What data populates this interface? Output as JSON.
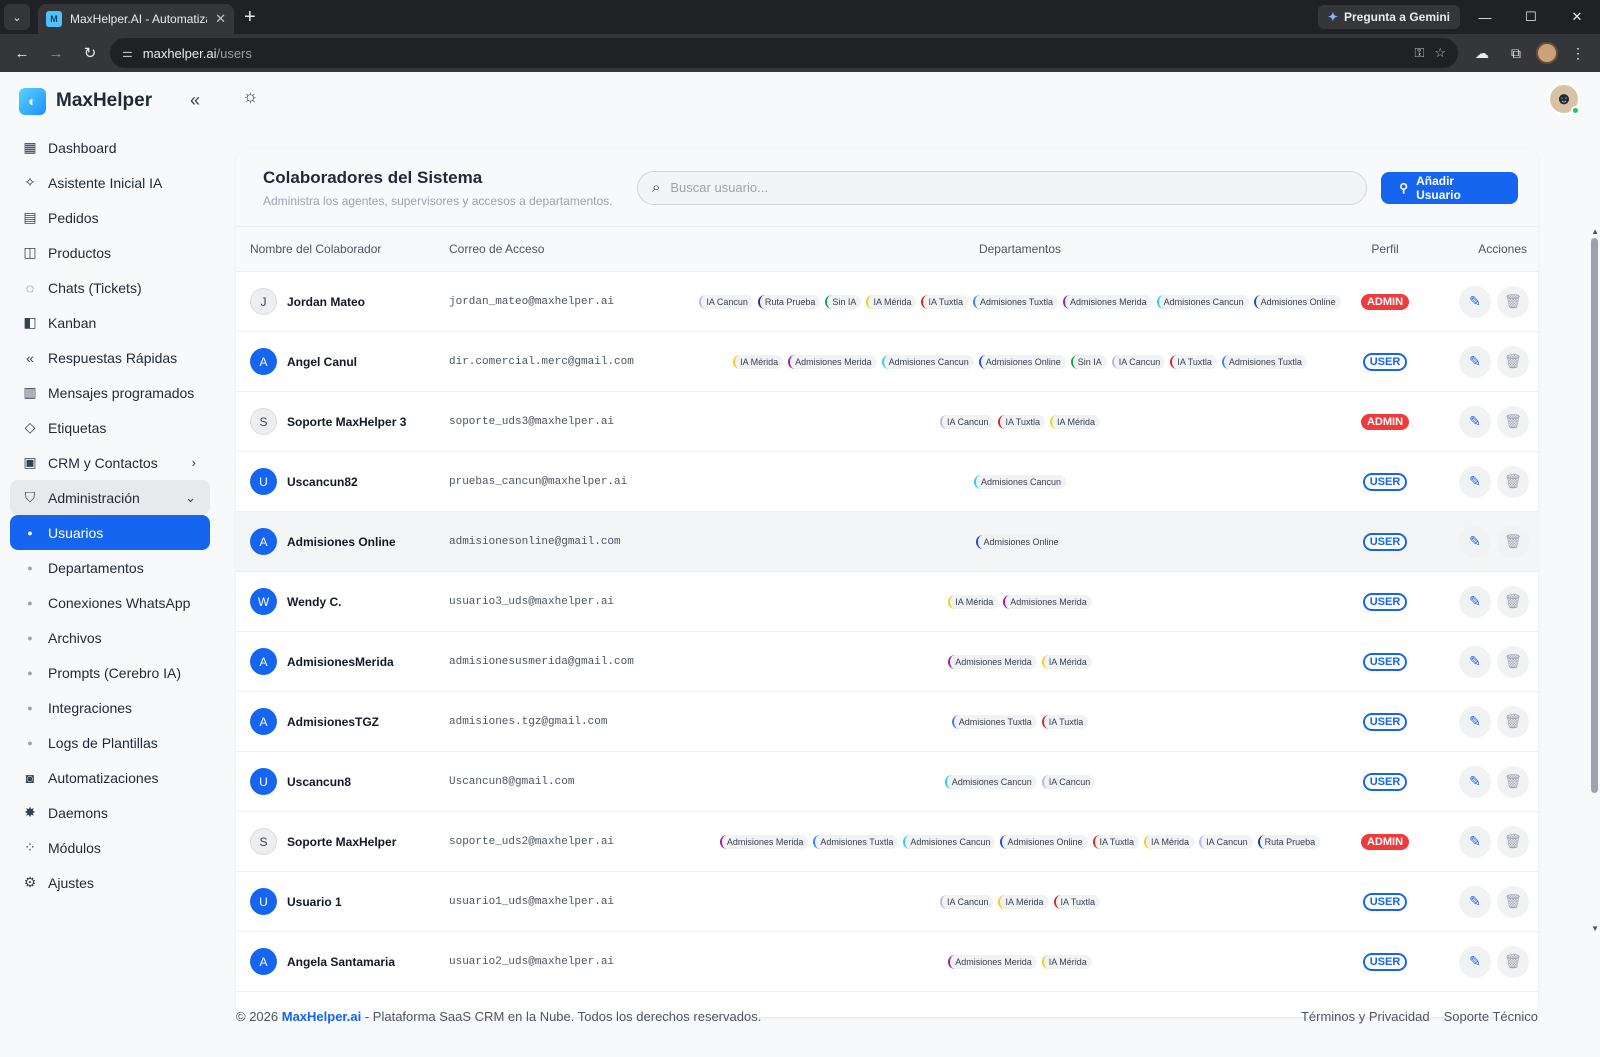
{
  "browser": {
    "tab_title": "MaxHelper.AI - Automatiza tu a",
    "new_tab": "+",
    "gemini_label": "Pregunta a Gemini",
    "url_host": "maxhelper.ai",
    "url_path": "/users"
  },
  "sidebar": {
    "brand": "MaxHelper",
    "items": [
      {
        "label": "Dashboard",
        "icon": "grid-icon",
        "glyph": "▦"
      },
      {
        "label": "Asistente Inicial IA",
        "icon": "sparkle-icon",
        "glyph": "✧"
      },
      {
        "label": "Pedidos",
        "icon": "document-icon",
        "glyph": "▤"
      },
      {
        "label": "Productos",
        "icon": "bag-icon",
        "glyph": "◫"
      },
      {
        "label": "Chats (Tickets)",
        "icon": "whatsapp-icon",
        "glyph": "◌"
      },
      {
        "label": "Kanban",
        "icon": "columns-icon",
        "glyph": "◧"
      },
      {
        "label": "Respuestas Rápidas",
        "icon": "reply-all-icon",
        "glyph": "«"
      },
      {
        "label": "Mensajes programados",
        "icon": "calendar-icon",
        "glyph": "▥"
      },
      {
        "label": "Etiquetas",
        "icon": "tag-icon",
        "glyph": "◇"
      },
      {
        "label": "CRM y Contactos",
        "icon": "contacts-icon",
        "glyph": "▣"
      }
    ],
    "admin": {
      "label": "Administración",
      "icon": "shield-user-icon",
      "glyph": "⛉"
    },
    "subitems": [
      {
        "label": "Usuarios",
        "active": true
      },
      {
        "label": "Departamentos"
      },
      {
        "label": "Conexiones WhatsApp"
      },
      {
        "label": "Archivos"
      },
      {
        "label": "Prompts (Cerebro IA)"
      },
      {
        "label": "Integraciones"
      },
      {
        "label": "Logs de Plantillas"
      }
    ],
    "bottom_items": [
      {
        "label": "Automatizaciones",
        "icon": "robot-icon",
        "glyph": "◙"
      },
      {
        "label": "Daemons",
        "icon": "daemon-icon",
        "glyph": "✸"
      },
      {
        "label": "Módulos",
        "icon": "modules-icon",
        "glyph": "⁘"
      },
      {
        "label": "Ajustes",
        "icon": "gear-icon",
        "glyph": "⚙"
      }
    ]
  },
  "page": {
    "title": "Colaboradores del Sistema",
    "subtitle": "Administra los agentes, supervisores y accesos a departamentos.",
    "search_placeholder": "Buscar usuario...",
    "add_button": "Añadir Usuario"
  },
  "table": {
    "headers": {
      "name": "Nombre del Colaborador",
      "email": "Correo de Acceso",
      "departments": "Departamentos",
      "profile": "Perfil",
      "actions": "Acciones"
    },
    "rows": [
      {
        "initial": "J",
        "avatar": "grey",
        "name": "Jordan Mateo",
        "email": "jordan_mateo@maxhelper.ai",
        "profile": "ADMIN",
        "departments": [
          "IA Cancun",
          "Ruta Prueba",
          "Sin IA",
          "IA Mérida",
          "IA Tuxtla",
          "Admisiones Tuxtla",
          "Admisiones Merida",
          "Admisiones Cancun",
          "Admisiones Online"
        ]
      },
      {
        "initial": "A",
        "avatar": "blue",
        "name": "Angel Canul",
        "email": "dir.comercial.merc@gmail.com",
        "profile": "USER",
        "departments": [
          "IA Mérida",
          "Admisiones Merida",
          "Admisiones Cancun",
          "Admisiones Online",
          "Sin IA",
          "IA Cancun",
          "IA Tuxtla",
          "Admisiones Tuxtla"
        ]
      },
      {
        "initial": "S",
        "avatar": "grey",
        "name": "Soporte MaxHelper 3",
        "email": "soporte_uds3@maxhelper.ai",
        "profile": "ADMIN",
        "departments": [
          "IA Cancun",
          "IA Tuxtla",
          "IA Mérida"
        ]
      },
      {
        "initial": "U",
        "avatar": "blue",
        "name": "Uscancun82",
        "email": "pruebas_cancun@maxhelper.ai",
        "profile": "USER",
        "departments": [
          "Admisiones Cancun"
        ]
      },
      {
        "initial": "A",
        "avatar": "blue",
        "name": "Admisiones Online",
        "email": "admisionesonline@gmail.com",
        "profile": "USER",
        "highlight": true,
        "departments": [
          "Admisiones Online"
        ]
      },
      {
        "initial": "W",
        "avatar": "blue",
        "name": "Wendy C.",
        "email": "usuario3_uds@maxhelper.ai",
        "profile": "USER",
        "departments": [
          "IA Mérida",
          "Admisiones Merida"
        ]
      },
      {
        "initial": "A",
        "avatar": "blue",
        "name": "AdmisionesMerida",
        "email": "admisionesusmerida@gmail.com",
        "profile": "USER",
        "departments": [
          "Admisiones Merida",
          "IA Mérida"
        ]
      },
      {
        "initial": "A",
        "avatar": "blue",
        "name": "AdmisionesTGZ",
        "email": "admisiones.tgz@gmail.com",
        "profile": "USER",
        "departments": [
          "Admisiones Tuxtla",
          "IA Tuxtla"
        ]
      },
      {
        "initial": "U",
        "avatar": "blue",
        "name": "Uscancun8",
        "email": "Uscancun8@gmail.com",
        "profile": "USER",
        "departments": [
          "Admisiones Cancun",
          "IA Cancun"
        ]
      },
      {
        "initial": "S",
        "avatar": "grey",
        "name": "Soporte MaxHelper",
        "email": "soporte_uds2@maxhelper.ai",
        "profile": "ADMIN",
        "departments": [
          "Admisiones Merida",
          "Admisiones Tuxtla",
          "Admisiones Cancun",
          "Admisiones Online",
          "IA Tuxtla",
          "IA Mérida",
          "IA Cancun",
          "Ruta Prueba"
        ]
      },
      {
        "initial": "U",
        "avatar": "blue",
        "name": "Usuario 1",
        "email": "usuario1_uds@maxhelper.ai",
        "profile": "USER",
        "departments": [
          "IA Cancun",
          "IA Mérida",
          "IA Tuxtla"
        ]
      },
      {
        "initial": "A",
        "avatar": "blue",
        "name": "Angela Santamaria",
        "email": "usuario2_uds@maxhelper.ai",
        "profile": "USER",
        "departments": [
          "Admisiones Merida",
          "IA Mérida"
        ]
      }
    ]
  },
  "department_colors": {
    "IA Cancun": "#b8b4ea",
    "Ruta Prueba": "#1e3a8a",
    "Sin IA": "#16a34a",
    "IA Mérida": "#facc15",
    "IA Tuxtla": "#dc2626",
    "Admisiones Tuxtla": "#3b82f6",
    "Admisiones Merida": "#a21caf",
    "Admisiones Cancun": "#22d3ee",
    "Admisiones Online": "#1d4ed8"
  },
  "footer": {
    "copyright_prefix": "© 2026 ",
    "brand": "MaxHelper.ai",
    "copyright_suffix": " - Plataforma SaaS CRM en la Nube. Todos los derechos reservados.",
    "terms": "Términos y Privacidad",
    "support": "Soporte Técnico"
  },
  "colors": {
    "accent": "#1565f0",
    "admin_badge": "#ef3b3b"
  }
}
